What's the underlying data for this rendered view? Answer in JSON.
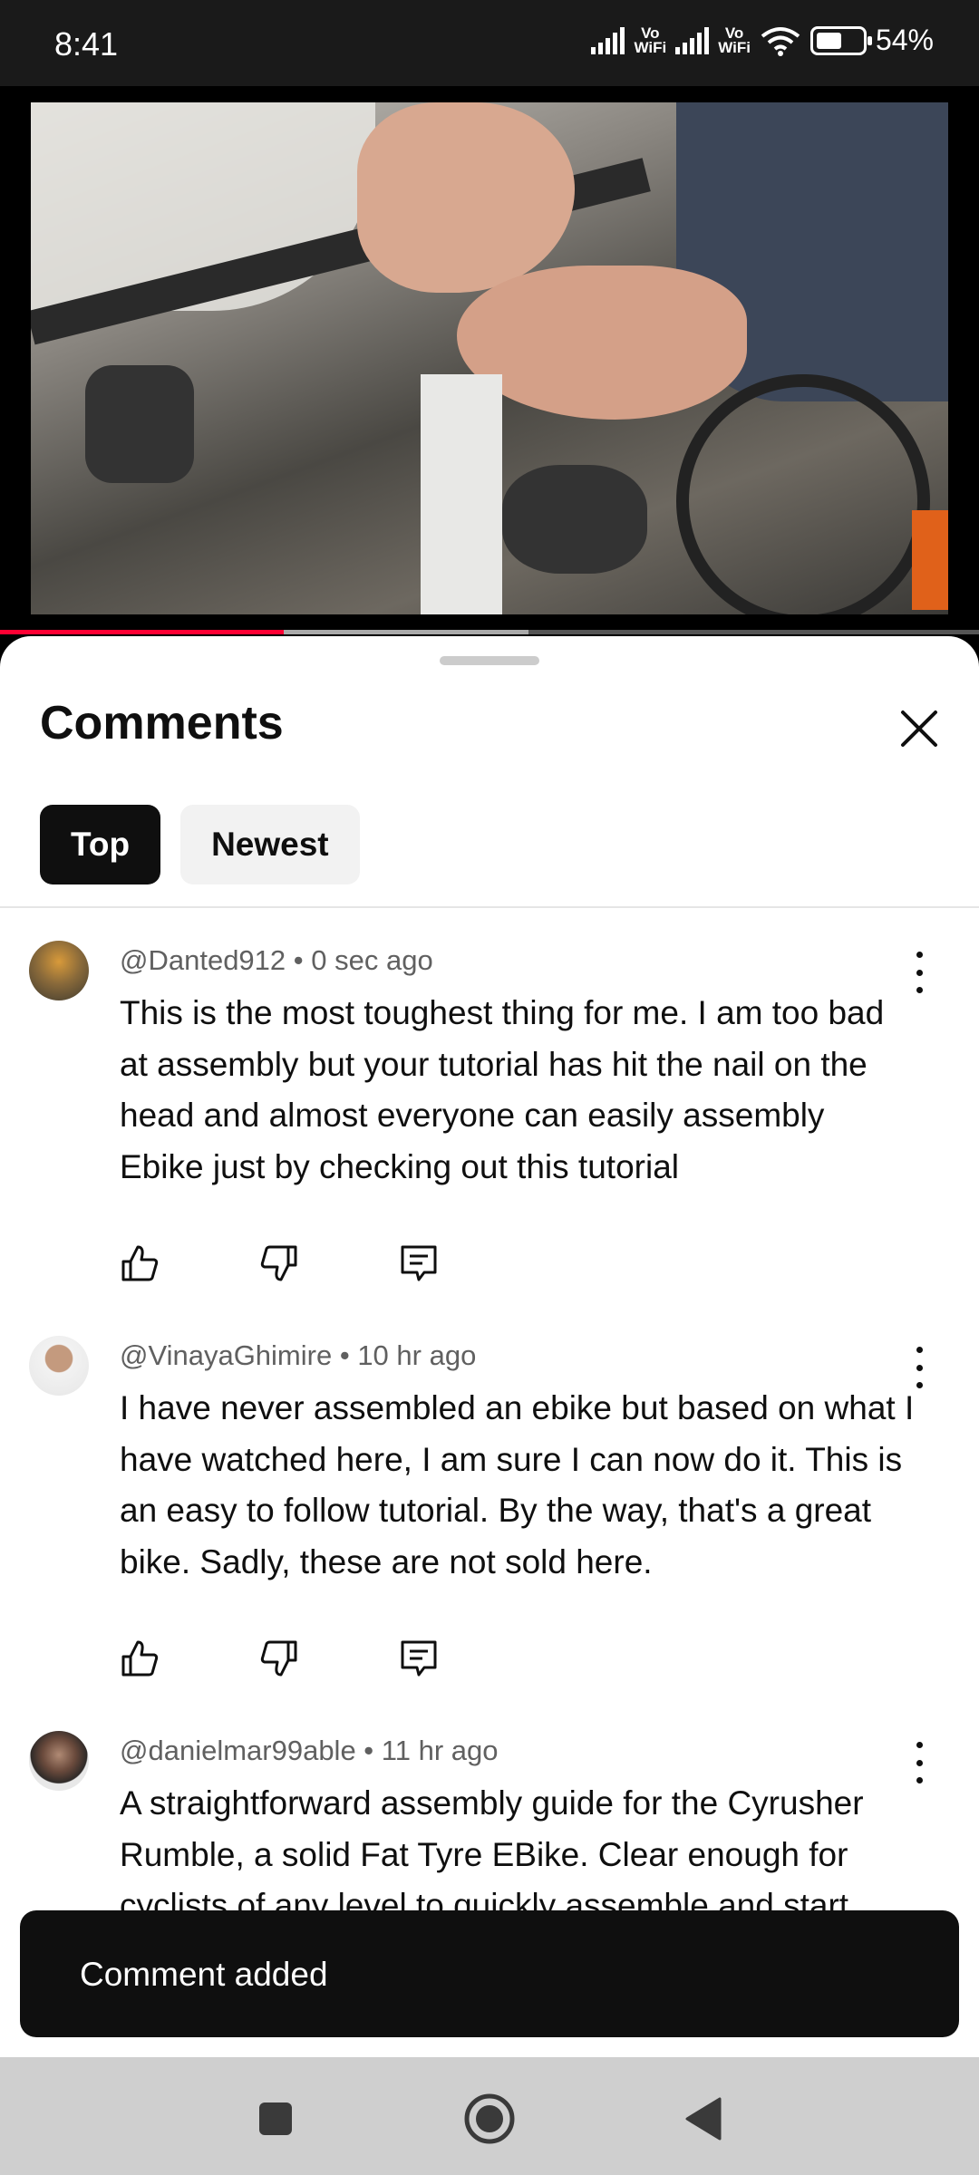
{
  "status_bar": {
    "time": "8:41",
    "sim1_label": "Vo\nWiFi",
    "sim2_label": "Vo\nWiFi",
    "battery_percent": "54%",
    "battery_level": 0.54
  },
  "video": {
    "progress_played": 0.29,
    "progress_buffered": 0.54
  },
  "comments_panel": {
    "title": "Comments",
    "close_icon": "close-icon",
    "filters": [
      {
        "label": "Top",
        "active": true
      },
      {
        "label": "Newest",
        "active": false
      }
    ],
    "comments": [
      {
        "author": "@Danted912",
        "time": "0 sec ago",
        "text": "This is the most toughest thing for me. I am too bad at assembly but your tutorial has hit the nail on the head and almost everyone can easily assembly Ebike just by checking out this tutorial",
        "avatar_color": "#8a6a3a"
      },
      {
        "author": "@VinayaGhimire",
        "time": "10 hr ago",
        "text": "I have never assembled an ebike but based on what I have watched here, I am sure I can now do it. This is an easy to follow tutorial. By the way, that's a great bike. Sadly, these are not sold here.",
        "avatar_color": "#c9b3a0"
      },
      {
        "author": "@danielmar99able",
        "time": "11 hr ago",
        "text": "A straightforward assembly guide for the Cyrusher Rumble, a solid Fat Tyre EBike. Clear enough for cyclists of any level to quickly assemble and start",
        "avatar_color": "#5a4a40"
      }
    ]
  },
  "toast": {
    "message": "Comment added"
  },
  "nav_bar": {
    "buttons": [
      "recents-icon",
      "home-icon",
      "back-icon"
    ]
  },
  "colors": {
    "accent_red": "#ff0033",
    "chip_active_bg": "#0f0f0f",
    "chip_bg": "#f2f2f2",
    "meta_text": "#606060"
  }
}
